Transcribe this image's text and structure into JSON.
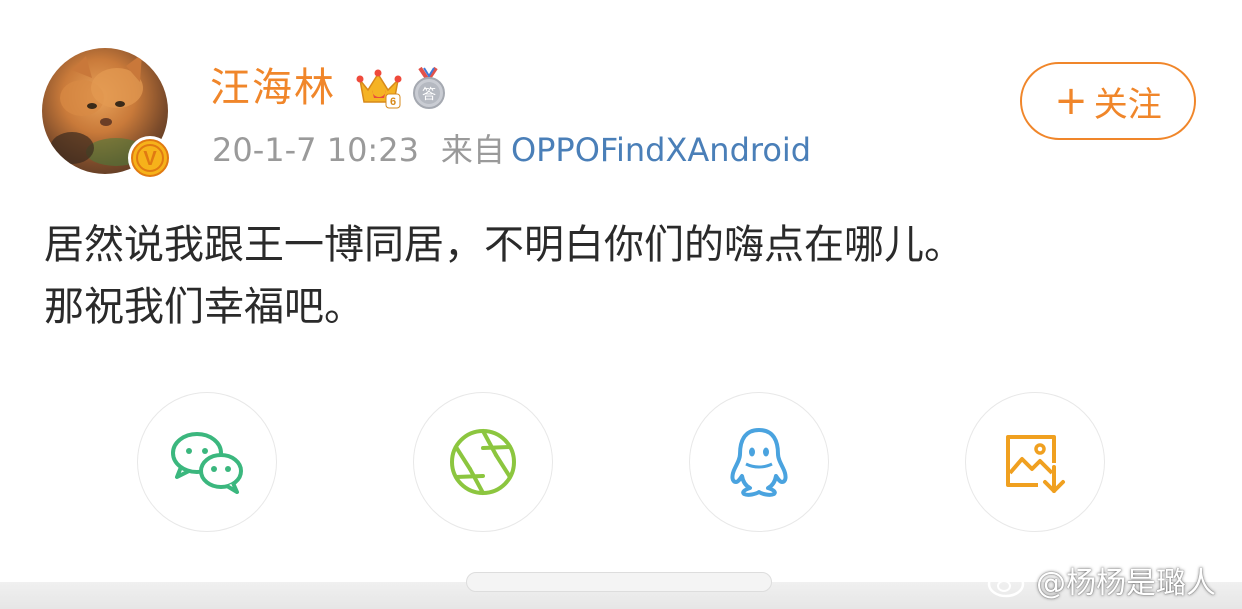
{
  "user": {
    "name": "汪海林",
    "verified_badge_letter": "V",
    "level_badge_number": "6",
    "medal_badge_char": "答"
  },
  "post_meta": {
    "timestamp": "20-1-7 10:23",
    "source_label": "来自",
    "source_device": "OPPOFindXAndroid"
  },
  "follow_button": {
    "plus": "+",
    "label": "关注"
  },
  "post_text": {
    "line1": "居然说我跟王一博同居，不明白你们的嗨点在哪儿。",
    "line2": "那祝我们幸福吧。"
  },
  "share_targets": [
    {
      "icon": "wechat-icon",
      "color": "#3bb77e"
    },
    {
      "icon": "moments-icon",
      "color": "#8cc63f"
    },
    {
      "icon": "qq-icon",
      "color": "#4aa3df"
    },
    {
      "icon": "save-image-icon",
      "color": "#f0a020"
    }
  ],
  "watermark": {
    "text": "@杨杨是璐人"
  },
  "colors": {
    "accent": "#f0862a",
    "link": "#4a7fb8",
    "meta_gray": "#9a9a9a"
  }
}
